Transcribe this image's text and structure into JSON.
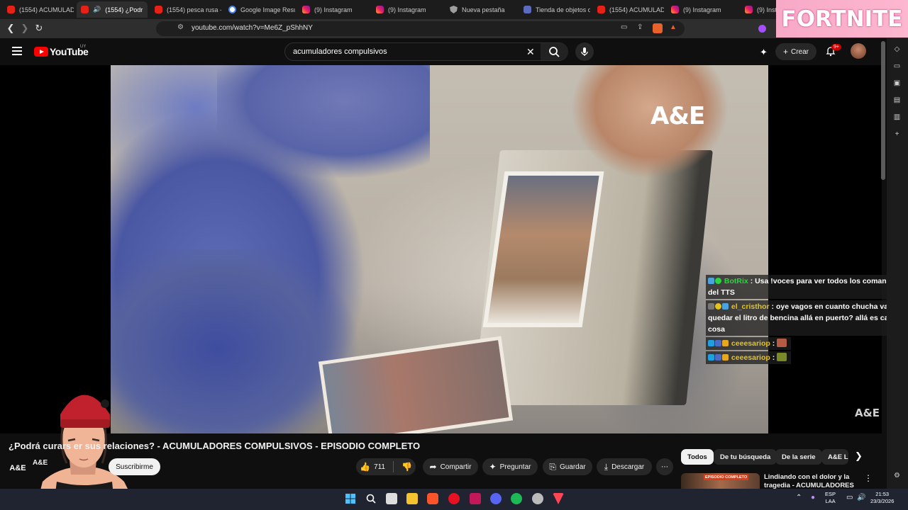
{
  "browser": {
    "tabs": [
      {
        "label": "(1554) ACUMULADO",
        "icon": "youtube"
      },
      {
        "label": "(1554) ¿Podr",
        "icon": "youtube",
        "active": true
      },
      {
        "label": "(1554) pesca rusa -",
        "icon": "youtube"
      },
      {
        "label": "Google Image Resu",
        "icon": "google"
      },
      {
        "label": "(9) Instagram",
        "icon": "instagram"
      },
      {
        "label": "(9) Instagram",
        "icon": "instagram"
      },
      {
        "label": "Nueva pestaña",
        "icon": "shield"
      },
      {
        "label": "Tienda de objetos d",
        "icon": "doc"
      },
      {
        "label": "(1554) ACUMULAD",
        "icon": "youtube"
      },
      {
        "label": "(9) Instagram",
        "icon": "instagram"
      },
      {
        "label": "(9) Instag",
        "icon": "instagram"
      }
    ],
    "url": "youtube.com/watch?v=Me6Z_pShhNY",
    "ad_banner": "FORTNITE"
  },
  "youtube": {
    "logo": "YouTube",
    "country": "UY",
    "search_query": "acumuladores compulsivos",
    "create_label": "Crear",
    "notif_count": "9+"
  },
  "video": {
    "watermark": "A&E",
    "watermark_small": "A&E",
    "title": "¿Podrá curars                   er sus relaciones? - ACUMULADORES COMPULSIVOS - EPISODIO COMPLETO",
    "channel_short": "A&E",
    "channel_name": "A&E",
    "subscribe_label": "Suscribirme",
    "likes": "711",
    "share_label": "Compartir",
    "ask_label": "Preguntar",
    "save_label": "Guardar",
    "download_label": "Descargar"
  },
  "chat": [
    {
      "user": "BotRix",
      "color": "green",
      "text": ": Usa !voces para ver todos los comandos del TTS"
    },
    {
      "user": "el_cristhor",
      "color": "yellow",
      "text": ": oye vagos en cuanto chucha va a quedar el litro de bencina allá en puerto? allá es cara la cosa"
    },
    {
      "user": "ceeesariop",
      "color": "yellow",
      "text": ":"
    },
    {
      "user": "ceeesariop",
      "color": "yellow",
      "text": ":"
    }
  ],
  "chips": [
    "Todos",
    "De tu búsqueda",
    "De la serie",
    "A&E L"
  ],
  "recommendation": {
    "thumb_badge": "EPISODIO COMPLETO",
    "title": "Lindiando con el dolor y la tragedia - ACUMULADORES"
  },
  "taskbar": {
    "lang": "ESP",
    "layout": "LAA",
    "time": "21:53",
    "date": "23/3/2026"
  }
}
